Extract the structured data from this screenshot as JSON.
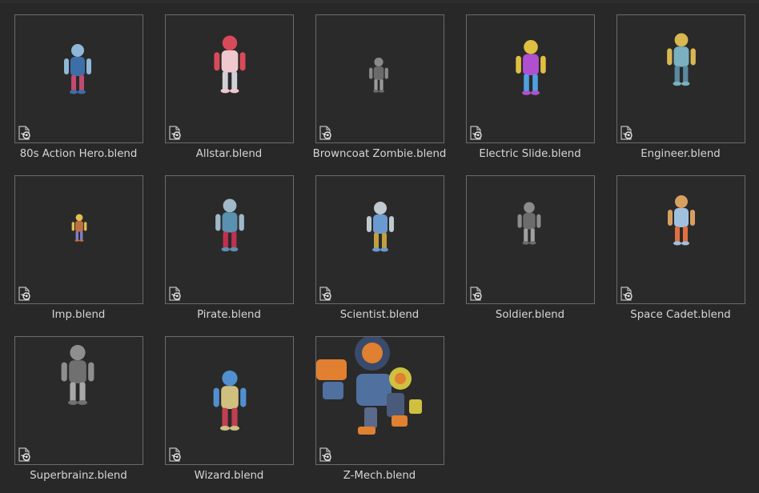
{
  "file_browser": {
    "items": [
      {
        "label": "80s Action Hero.blend",
        "icon": "blend-file-icon",
        "preview": "80s-action-hero-preview",
        "colors": [
          "#8fb8d8",
          "#3c6ea8",
          "#c04a70"
        ]
      },
      {
        "label": "Allstar.blend",
        "icon": "blend-file-icon",
        "preview": "allstar-preview",
        "colors": [
          "#d84a5a",
          "#f0c8d0",
          "#d0d0d8"
        ]
      },
      {
        "label": "Browncoat Zombie.blend",
        "icon": "blend-file-icon",
        "preview": "browncoat-zombie-preview",
        "colors": [
          "#8a8a8a",
          "#6a6a6a",
          "#9a9a9a"
        ]
      },
      {
        "label": "Electric Slide.blend",
        "icon": "blend-file-icon",
        "preview": "electric-slide-preview",
        "colors": [
          "#e0c040",
          "#b050d0",
          "#50a0e0"
        ]
      },
      {
        "label": "Engineer.blend",
        "icon": "blend-file-icon",
        "preview": "engineer-preview",
        "colors": [
          "#d8b850",
          "#7ab0c0",
          "#5a8aa0"
        ]
      },
      {
        "label": "Imp.blend",
        "icon": "blend-file-icon",
        "preview": "imp-preview",
        "colors": [
          "#e0c050",
          "#c07040",
          "#8080d0"
        ]
      },
      {
        "label": "Pirate.blend",
        "icon": "blend-file-icon",
        "preview": "pirate-preview",
        "colors": [
          "#a0b8c8",
          "#5a90b0",
          "#c03050"
        ]
      },
      {
        "label": "Scientist.blend",
        "icon": "blend-file-icon",
        "preview": "scientist-preview",
        "colors": [
          "#c0c8d0",
          "#6a9ad0",
          "#c0a040"
        ]
      },
      {
        "label": "Soldier.blend",
        "icon": "blend-file-icon",
        "preview": "soldier-preview",
        "colors": [
          "#8c8c8c",
          "#6c6c6c",
          "#a0a0a0"
        ]
      },
      {
        "label": "Space Cadet.blend",
        "icon": "blend-file-icon",
        "preview": "space-cadet-preview",
        "colors": [
          "#d8a060",
          "#a0c0e0",
          "#e07040"
        ]
      },
      {
        "label": "Superbrainz.blend",
        "icon": "blend-file-icon",
        "preview": "superbrainz-preview",
        "colors": [
          "#8e8e8e",
          "#707070",
          "#a8a8a8"
        ]
      },
      {
        "label": "Wizard.blend",
        "icon": "blend-file-icon",
        "preview": "wizard-preview",
        "colors": [
          "#5090d0",
          "#d0c080",
          "#c04050"
        ]
      },
      {
        "label": "Z-Mech.blend",
        "icon": "blend-file-icon",
        "preview": "z-mech-preview",
        "colors": [
          "#e08030",
          "#5070a0",
          "#d0c040"
        ]
      }
    ]
  }
}
